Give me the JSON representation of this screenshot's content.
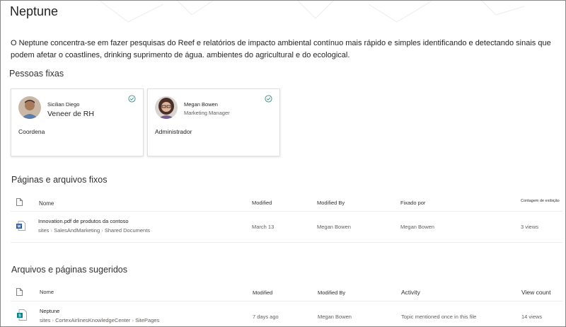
{
  "page": {
    "title": "Neptune",
    "description": "O Neptune concentra-se em fazer pesquisas do Reef e relatórios de impacto ambiental contínuo mais rápido e simples identificando e detectando sinais que podem afetar o coastlines, drinking suprimento de água. ambientes do agricultural e do ecological."
  },
  "people_section": {
    "heading": "Pessoas fixas",
    "people": [
      {
        "name": "Sicilian Diego",
        "title": "Veneer de RH",
        "role": "Coordena"
      },
      {
        "name": "Megan Bowen",
        "title": "Marketing Manager",
        "role": "Administrador"
      }
    ]
  },
  "pinned_section": {
    "heading": "Páginas e arquivos fixos",
    "columns": {
      "name": "Nome",
      "modified": "Modified",
      "modified_by": "Modified By",
      "pinned_by": "Fixado por",
      "edit_count": "Contagem de exibição"
    },
    "rows": [
      {
        "name": "Innovation.pdf de produtos da contoso",
        "path": [
          "sites",
          "SalesAndMarketing",
          "Shared Documents"
        ],
        "modified": "March 13",
        "modified_by": "Megan Bowen",
        "pinned_by": "Megan Bowen",
        "views": "3 views",
        "icon": "word-file-icon"
      }
    ]
  },
  "suggested_section": {
    "heading": "Arquivos e páginas sugeridos",
    "columns": {
      "name": "Nome",
      "modified": "Modified",
      "modified_by": "Modified By",
      "activity": "Activity",
      "view_count": "View count"
    },
    "rows": [
      {
        "name": "Neptune",
        "path": [
          "sites",
          "CortexAirlinesKnowledgeCenter",
          "SitePages"
        ],
        "modified": "7 days ago",
        "modified_by": "Megan Bowen",
        "activity": "Topic mentioned once in this file",
        "views": "14 views",
        "icon": "sharepoint-page-icon"
      }
    ]
  },
  "colors": {
    "word_blue": "#2b579a",
    "sharepoint_teal": "#038387",
    "check_teal": "#3a8f8a"
  }
}
